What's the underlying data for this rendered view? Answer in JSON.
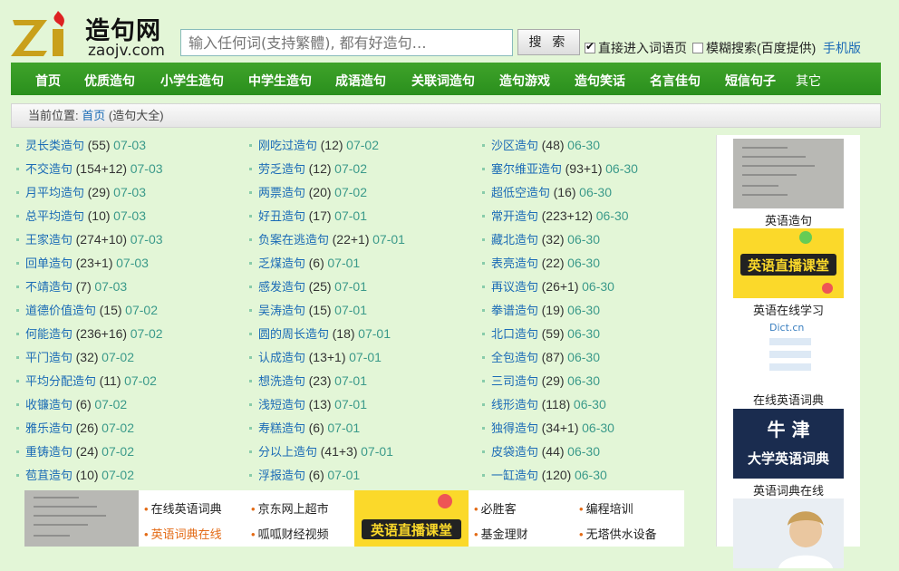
{
  "logo": {
    "cn": "造句网",
    "en": "zaojv.com"
  },
  "search": {
    "placeholder": "输入任何词(支持繁體), 都有好造句…",
    "button": "搜 索"
  },
  "options": [
    {
      "label": "直接进入词语页",
      "checked": true
    },
    {
      "label": "模糊搜索(百度提供)",
      "checked": false
    }
  ],
  "mobile_link": "手机版",
  "nav": [
    "首页",
    "优质造句",
    "小学生造句",
    "中学生造句",
    "成语造句",
    "关联词造句",
    "造句游戏",
    "造句笑话",
    "名言佳句",
    "短信句子",
    "其它"
  ],
  "breadcrumb": {
    "label": "当前位置:",
    "home": "首页",
    "current": "(造句大全)"
  },
  "columns": [
    [
      {
        "w": "灵长类造句",
        "c": "(55)",
        "d": "07-03"
      },
      {
        "w": "不交造句",
        "c": "(154+12)",
        "d": "07-03"
      },
      {
        "w": "月平均造句",
        "c": "(29)",
        "d": "07-03"
      },
      {
        "w": "总平均造句",
        "c": "(10)",
        "d": "07-03"
      },
      {
        "w": "王家造句",
        "c": "(274+10)",
        "d": "07-03"
      },
      {
        "w": "回单造句",
        "c": "(23+1)",
        "d": "07-03"
      },
      {
        "w": "不靖造句",
        "c": "(7)",
        "d": "07-03"
      },
      {
        "w": "道德价值造句",
        "c": "(15)",
        "d": "07-02"
      },
      {
        "w": "何能造句",
        "c": "(236+16)",
        "d": "07-02"
      },
      {
        "w": "平门造句",
        "c": "(32)",
        "d": "07-02"
      },
      {
        "w": "平均分配造句",
        "c": "(11)",
        "d": "07-02"
      },
      {
        "w": "收镰造句",
        "c": "(6)",
        "d": "07-02"
      },
      {
        "w": "雅乐造句",
        "c": "(26)",
        "d": "07-02"
      },
      {
        "w": "重铸造句",
        "c": "(24)",
        "d": "07-02"
      },
      {
        "w": "苞苴造句",
        "c": "(10)",
        "d": "07-02"
      }
    ],
    [
      {
        "w": "刚吃过造句",
        "c": "(12)",
        "d": "07-02"
      },
      {
        "w": "劳乏造句",
        "c": "(12)",
        "d": "07-02"
      },
      {
        "w": "两票造句",
        "c": "(20)",
        "d": "07-02"
      },
      {
        "w": "好丑造句",
        "c": "(17)",
        "d": "07-01"
      },
      {
        "w": "负案在逃造句",
        "c": "(22+1)",
        "d": "07-01"
      },
      {
        "w": "乏煤造句",
        "c": "(6)",
        "d": "07-01"
      },
      {
        "w": "感发造句",
        "c": "(25)",
        "d": "07-01"
      },
      {
        "w": "吴涛造句",
        "c": "(15)",
        "d": "07-01"
      },
      {
        "w": "圆的周长造句",
        "c": "(18)",
        "d": "07-01"
      },
      {
        "w": "认成造句",
        "c": "(13+1)",
        "d": "07-01"
      },
      {
        "w": "想洗造句",
        "c": "(23)",
        "d": "07-01"
      },
      {
        "w": "浅短造句",
        "c": "(13)",
        "d": "07-01"
      },
      {
        "w": "寿糕造句",
        "c": "(6)",
        "d": "07-01"
      },
      {
        "w": "分以上造句",
        "c": "(41+3)",
        "d": "07-01"
      },
      {
        "w": "浮报造句",
        "c": "(6)",
        "d": "07-01"
      }
    ],
    [
      {
        "w": "沙区造句",
        "c": "(48)",
        "d": "06-30"
      },
      {
        "w": "塞尔维亚造句",
        "c": "(93+1)",
        "d": "06-30"
      },
      {
        "w": "超低空造句",
        "c": "(16)",
        "d": "06-30"
      },
      {
        "w": "常开造句",
        "c": "(223+12)",
        "d": "06-30"
      },
      {
        "w": "藏北造句",
        "c": "(32)",
        "d": "06-30"
      },
      {
        "w": "表亮造句",
        "c": "(22)",
        "d": "06-30"
      },
      {
        "w": "再议造句",
        "c": "(26+1)",
        "d": "06-30"
      },
      {
        "w": "拳谱造句",
        "c": "(19)",
        "d": "06-30"
      },
      {
        "w": "北口造句",
        "c": "(59)",
        "d": "06-30"
      },
      {
        "w": "全包造句",
        "c": "(87)",
        "d": "06-30"
      },
      {
        "w": "三司造句",
        "c": "(29)",
        "d": "06-30"
      },
      {
        "w": "线形造句",
        "c": "(118)",
        "d": "06-30"
      },
      {
        "w": "独得造句",
        "c": "(34+1)",
        "d": "06-30"
      },
      {
        "w": "皮袋造句",
        "c": "(44)",
        "d": "06-30"
      },
      {
        "w": "一缸造句",
        "c": "(120)",
        "d": "06-30"
      }
    ]
  ],
  "sidebar": [
    {
      "label": "英语造句",
      "img": "paper"
    },
    {
      "label": "英语在线学习",
      "img": "live-class"
    },
    {
      "label": "在线英语词典",
      "img": "dict"
    },
    {
      "label": "英语词典在线",
      "img": "oxford",
      "text1": "牛 津",
      "text2": "大学英语词典"
    },
    {
      "img": "person"
    }
  ],
  "live_banner_text": "英语直播课堂",
  "bottom_links": [
    {
      "label": "在线英语词典",
      "orange": false
    },
    {
      "label": "京东网上超市",
      "orange": false
    },
    {
      "label": "必胜客",
      "orange": false
    },
    {
      "label": "编程培训",
      "orange": false
    },
    {
      "label": "英语词典在线",
      "orange": true
    },
    {
      "label": "呱呱财经视频",
      "orange": false
    },
    {
      "label": "基金理财",
      "orange": false
    },
    {
      "label": "无塔供水设备",
      "orange": false
    }
  ],
  "colors": {
    "nav_green": "#2a8f1d",
    "link_blue": "#1b6bb6",
    "date_teal": "#3b9a8a",
    "page_bg": "#e3f6d7"
  }
}
